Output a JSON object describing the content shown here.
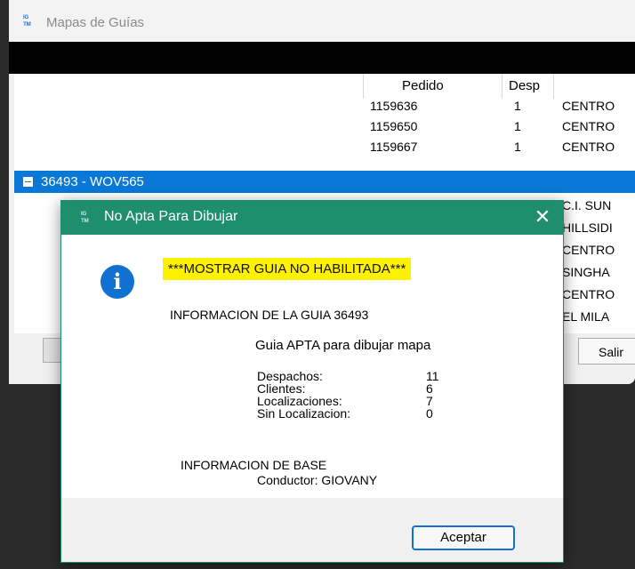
{
  "main_window": {
    "title": "Mapas de Guías",
    "icon": "app-map-icon",
    "columns": [
      "Pedido",
      "Desp",
      ""
    ],
    "rows_top": [
      {
        "pedido": "1159636",
        "desp": "1",
        "destino": "CENTRO"
      },
      {
        "pedido": "1159650",
        "desp": "1",
        "destino": "CENTRO"
      },
      {
        "pedido": "1159667",
        "desp": "1",
        "destino": "CENTRO"
      }
    ],
    "group_row": "36493 - WOV565",
    "rows_partial": [
      "C.I. SUN",
      "HILLSIDI",
      "CENTRO",
      "SINGHA",
      "CENTRO",
      "EL MILA"
    ],
    "salir_label": "Salir"
  },
  "dialog": {
    "title": "No Apta Para Dibujar",
    "close_glyph": "✕",
    "info_glyph": "i",
    "warning": "***MOSTRAR GUIA NO HABILITADA***",
    "guia_info": "INFORMACION DE LA GUIA 36493",
    "apta": "Guia APTA para dibujar mapa",
    "stats": [
      {
        "label": "Despachos:",
        "value": "11"
      },
      {
        "label": "Clientes:",
        "value": "6"
      },
      {
        "label": "Localizaciones:",
        "value": "7"
      },
      {
        "label": "Sin Localizacion:",
        "value": "0"
      }
    ],
    "base_info": "INFORMACION DE BASE",
    "conductor": "Conductor: GIOVANY",
    "accept_label": "Aceptar"
  },
  "colors": {
    "dialog_title_bar": "#1e8e6d",
    "selection": "#0a78d7",
    "highlight": "#fff200",
    "info_icon": "#1270d1"
  }
}
